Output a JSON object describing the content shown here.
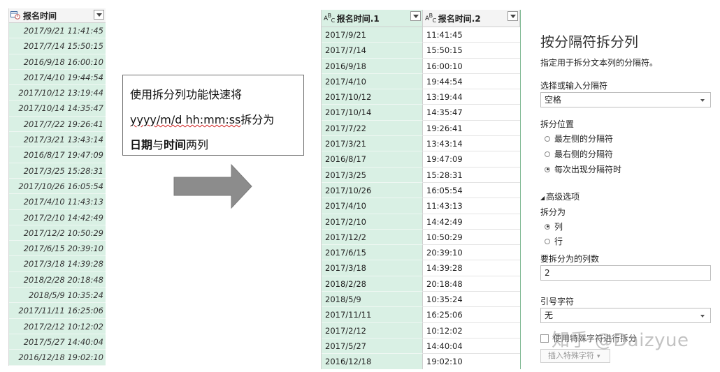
{
  "left_table": {
    "header": "报名时间",
    "header_icon": "datetime-type-icon",
    "rows": [
      "2017/9/21 11:41:45",
      "2017/7/14 15:50:15",
      "2016/9/18 16:00:10",
      "2017/4/10 19:44:54",
      "2017/10/12 13:19:44",
      "2017/10/14 14:35:47",
      "2017/7/22 19:26:41",
      "2017/3/21 13:43:14",
      "2016/8/17 19:47:09",
      "2017/3/25 15:28:31",
      "2017/10/26 16:05:54",
      "2017/4/10 11:43:13",
      "2017/2/10 14:42:49",
      "2017/12/2 10:50:29",
      "2017/6/15 20:39:10",
      "2017/3/18 14:39:28",
      "2018/2/28 20:18:48",
      "2018/5/9 10:35:24",
      "2017/11/11 16:25:06",
      "2017/2/12 10:12:02",
      "2017/5/27 14:40:04",
      "2016/12/18 19:02:10"
    ]
  },
  "callout": {
    "line1": "使用拆分列功能快速将",
    "line2_format": "yyyy/m/d hh:mm:ss",
    "line2_rest": "拆分为",
    "line3_bold1": "日期",
    "line3_mid": "与",
    "line3_bold2": "时间",
    "line3_end": "两列"
  },
  "right_table": {
    "col1_header": "报名时间.1",
    "col2_header": "报名时间.2",
    "type_icon": "text-type-icon",
    "rows": [
      [
        "2017/9/21",
        "11:41:45"
      ],
      [
        "2017/7/14",
        "15:50:15"
      ],
      [
        "2016/9/18",
        "16:00:10"
      ],
      [
        "2017/4/10",
        "19:44:54"
      ],
      [
        "2017/10/12",
        "13:19:44"
      ],
      [
        "2017/10/14",
        "14:35:47"
      ],
      [
        "2017/7/22",
        "19:26:41"
      ],
      [
        "2017/3/21",
        "13:43:14"
      ],
      [
        "2016/8/17",
        "19:47:09"
      ],
      [
        "2017/3/25",
        "15:28:31"
      ],
      [
        "2017/10/26",
        "16:05:54"
      ],
      [
        "2017/4/10",
        "11:43:13"
      ],
      [
        "2017/2/10",
        "14:42:49"
      ],
      [
        "2017/12/2",
        "10:50:29"
      ],
      [
        "2017/6/15",
        "20:39:10"
      ],
      [
        "2017/3/18",
        "14:39:28"
      ],
      [
        "2018/2/28",
        "20:18:48"
      ],
      [
        "2018/5/9",
        "10:35:24"
      ],
      [
        "2017/11/11",
        "16:25:06"
      ],
      [
        "2017/2/12",
        "10:12:02"
      ],
      [
        "2017/5/27",
        "14:40:04"
      ],
      [
        "2016/12/18",
        "19:02:10"
      ]
    ]
  },
  "panel": {
    "title": "按分隔符拆分列",
    "description": "指定用于拆分文本列的分隔符。",
    "delimiter_label": "选择或输入分隔符",
    "delimiter_value": "空格",
    "split_position_label": "拆分位置",
    "split_options": [
      "最左侧的分隔符",
      "最右侧的分隔符",
      "每次出现分隔符时"
    ],
    "split_selected_index": 2,
    "advanced_label": "高级选项",
    "split_into_label": "拆分为",
    "split_into_options": [
      "列",
      "行"
    ],
    "split_into_selected_index": 0,
    "num_columns_label": "要拆分为的列数",
    "num_columns_value": "2",
    "quote_char_label": "引号字符",
    "quote_char_value": "无",
    "special_char_checkbox_label": "使用特殊字符进行拆分",
    "insert_special_char_button": "插入特殊字符"
  },
  "watermark": "知乎 @Daizyue",
  "colors": {
    "selected_column_bg": "#d9f0e4",
    "arrow_fill": "#8c8c8c",
    "wavy_underline": "#d02020"
  }
}
